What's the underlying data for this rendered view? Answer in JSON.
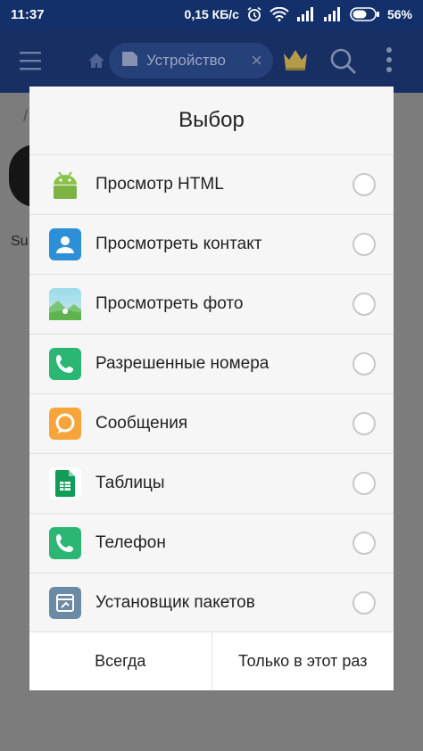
{
  "status_bar": {
    "time": "11:37",
    "speed": "0,15 КБ/с",
    "battery": "56%"
  },
  "app_bar": {
    "tab_label": "Устройство",
    "tab_close": "×"
  },
  "background": {
    "path_slash": "/",
    "user_label": "Su"
  },
  "dialog": {
    "title": "Выбор",
    "options": [
      {
        "label": "Просмотр HTML",
        "icon": "android-icon"
      },
      {
        "label": "Просмотреть контакт",
        "icon": "contact-icon"
      },
      {
        "label": "Просмотреть фото",
        "icon": "photo-icon"
      },
      {
        "label": "Разрешенные номера",
        "icon": "phone-icon"
      },
      {
        "label": "Сообщения",
        "icon": "message-icon"
      },
      {
        "label": "Таблицы",
        "icon": "sheets-icon"
      },
      {
        "label": "Телефон",
        "icon": "phone-icon"
      },
      {
        "label": "Установщик пакетов",
        "icon": "package-installer-icon"
      }
    ],
    "actions": {
      "always": "Всегда",
      "just_once": "Только в этот раз"
    }
  },
  "colors": {
    "status_bar": "#13306a",
    "app_bar": "#182f64",
    "android_green": "#8bc34a",
    "contact_blue": "#2d8fd5",
    "phone_green": "#2bb673",
    "message_orange": "#f7a53a",
    "sheets_green": "#0f9d58",
    "installer_gray": "#6b8aa6"
  }
}
